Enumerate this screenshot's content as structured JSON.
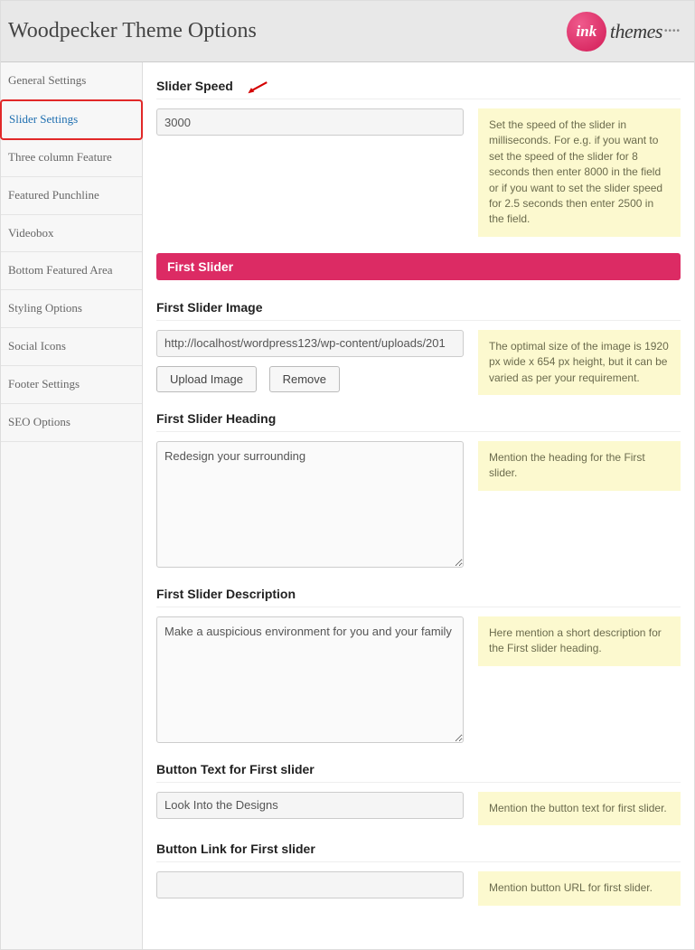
{
  "header": {
    "title": "Woodpecker Theme Options",
    "logo_ink": "ink",
    "logo_themes": "themes"
  },
  "sidebar": {
    "items": [
      {
        "label": "General Settings"
      },
      {
        "label": "Slider Settings"
      },
      {
        "label": "Three column Feature"
      },
      {
        "label": "Featured Punchline"
      },
      {
        "label": "Videobox"
      },
      {
        "label": "Bottom Featured Area"
      },
      {
        "label": "Styling Options"
      },
      {
        "label": "Social Icons"
      },
      {
        "label": "Footer Settings"
      },
      {
        "label": "SEO Options"
      }
    ]
  },
  "sections": {
    "slider_speed": {
      "title": "Slider Speed",
      "value": "3000",
      "help": "Set the speed of the slider in milliseconds. For e.g. if you want to set the speed of the slider for 8 seconds then enter 8000 in the field or if you want to set the slider speed for 2.5 seconds then enter 2500 in the field."
    },
    "first_slider_banner": "First Slider",
    "first_slider_image": {
      "title": "First Slider Image",
      "value": "http://localhost/wordpress123/wp-content/uploads/201",
      "upload_label": "Upload Image",
      "remove_label": "Remove",
      "help": "The optimal size of the image is 1920 px wide x 654 px height, but it can be varied as per your requirement."
    },
    "first_slider_heading": {
      "title": "First Slider Heading",
      "value": "Redesign your surrounding",
      "help": "Mention the heading for the First slider."
    },
    "first_slider_description": {
      "title": "First Slider Description",
      "value": "Make a auspicious environment for you and your family",
      "help": "Here mention a short description for the First slider heading."
    },
    "button_text": {
      "title": "Button Text for First slider",
      "value": "Look Into the Designs",
      "help": "Mention the button text for first slider."
    },
    "button_link": {
      "title": "Button Link for First slider",
      "value": "",
      "help": "Mention button URL for first slider."
    }
  }
}
